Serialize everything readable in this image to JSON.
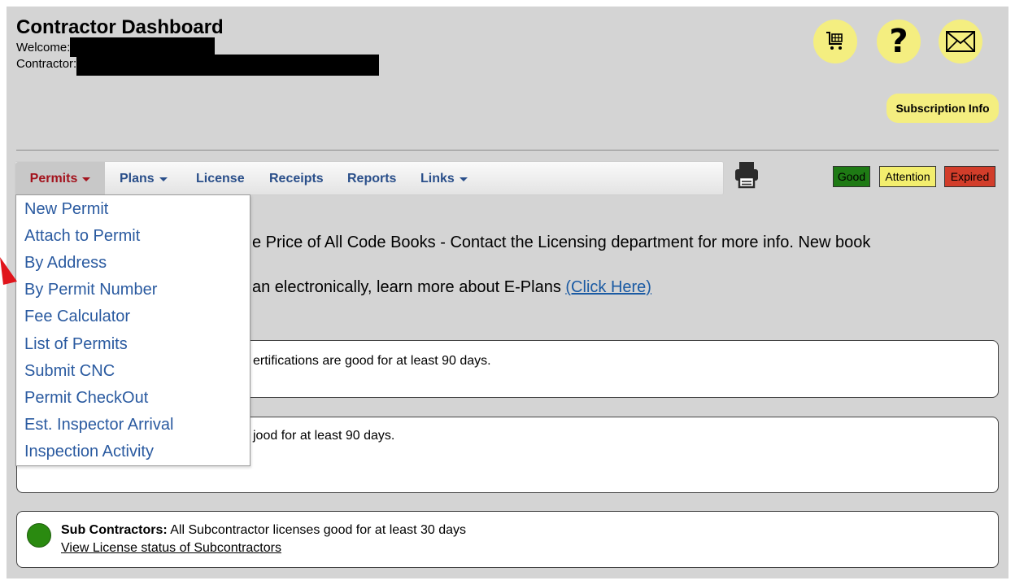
{
  "header": {
    "title": "Contractor Dashboard",
    "welcome_label": "Welcome:",
    "contractor_label": "Contractor:"
  },
  "header_icons": [
    "cart-icon",
    "help-icon",
    "mail-icon"
  ],
  "help_glyph": "?",
  "subscription_label": "Subscription Info",
  "nav": {
    "permits": "Permits",
    "plans": "Plans",
    "license": "License",
    "receipts": "Receipts",
    "reports": "Reports",
    "links": "Links"
  },
  "legend": {
    "good": "Good",
    "attention": "Attention",
    "expired": "Expired",
    "colors": {
      "good": "#1e7a14",
      "attention": "#f3ee6e",
      "expired": "#d23d2a"
    }
  },
  "accent_colors": {
    "nav_link": "#2a4f8a",
    "nav_active": "#a3131d",
    "badge": "#f4ee80",
    "link": "#1a5aa3"
  },
  "notice": {
    "line1": "e Price of All Code Books - Contact the Licensing department for more info. New book",
    "line2_text": "an electronically, learn more about E-Plans ",
    "line2_link": "(Click Here)"
  },
  "panels": {
    "panel1_text": "ertifications are good for at least 90 days.",
    "panel2_text": "jood for at least 90 days.",
    "sub_title": "Sub Contractors:",
    "sub_text": " All Subcontractor licenses good for at least 30 days",
    "sub_link": "View License status of Subcontractors"
  },
  "dropdown": [
    "New Permit",
    "Attach to Permit",
    "By Address",
    "By Permit Number",
    "Fee Calculator",
    "List of Permits",
    "Submit CNC",
    "Permit CheckOut",
    "Est. Inspector Arrival",
    "Inspection Activity"
  ]
}
